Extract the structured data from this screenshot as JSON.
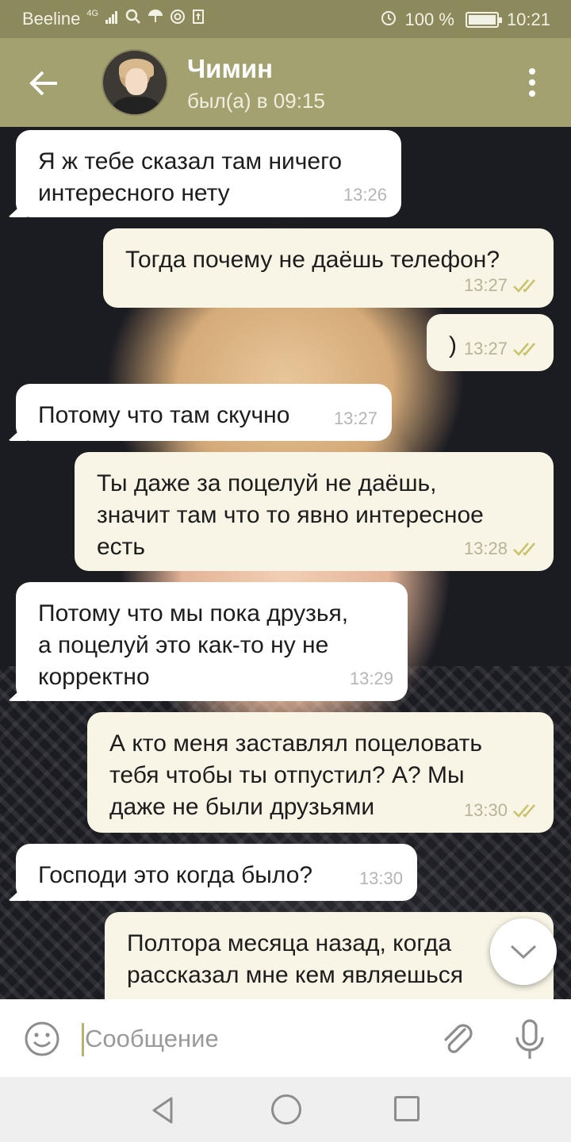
{
  "status_bar": {
    "carrier": "Beeline",
    "network": "4G",
    "battery": "100 %",
    "battery_level": 1.0,
    "time": "10:21",
    "icons": [
      "signal-icon",
      "search-icon",
      "umbrella-icon",
      "at-icon",
      "upload-icon",
      "alarm-icon",
      "battery-icon"
    ]
  },
  "header": {
    "contact_name": "Чимин",
    "contact_status": "был(а) в 09:15"
  },
  "messages": [
    {
      "direction": "in",
      "text": "Я ж тебе сказал там ничего\nинтересного нету",
      "time": "13:26"
    },
    {
      "direction": "out",
      "text": "Тогда почему не даёшь телефон?",
      "time": "13:27",
      "read": true
    },
    {
      "direction": "out",
      "text": ")",
      "time": "13:27",
      "read": true
    },
    {
      "direction": "in",
      "text": "Потому что там скучно",
      "time": "13:27"
    },
    {
      "direction": "out",
      "text": "Ты даже за поцелуй не даёшь,\nзначит там что то явно интересное\nесть",
      "time": "13:28",
      "read": true
    },
    {
      "direction": "in",
      "text": "Потому что мы пока друзья,\nа поцелуй это как-то ну не\nкорректно",
      "time": "13:29"
    },
    {
      "direction": "out",
      "text": "А кто меня заставлял поцеловать\nтебя чтобы ты отпустил? А? Мы\nдаже не были друзьями",
      "time": "13:30",
      "read": true
    },
    {
      "direction": "in",
      "text": "Господи это когда было?",
      "time": "13:30"
    },
    {
      "direction": "out",
      "text": "Полтора месяца назад, когда\nрассказал мне кем являешься",
      "time": "",
      "read": false
    }
  ],
  "composer": {
    "placeholder": "Сообщение"
  },
  "colors": {
    "status_bar": "#8c8a5c",
    "header": "#a3a170",
    "incoming_bubble": "#ffffff",
    "outgoing_bubble": "#f8f5e6",
    "read_check": "#c9c26a"
  }
}
